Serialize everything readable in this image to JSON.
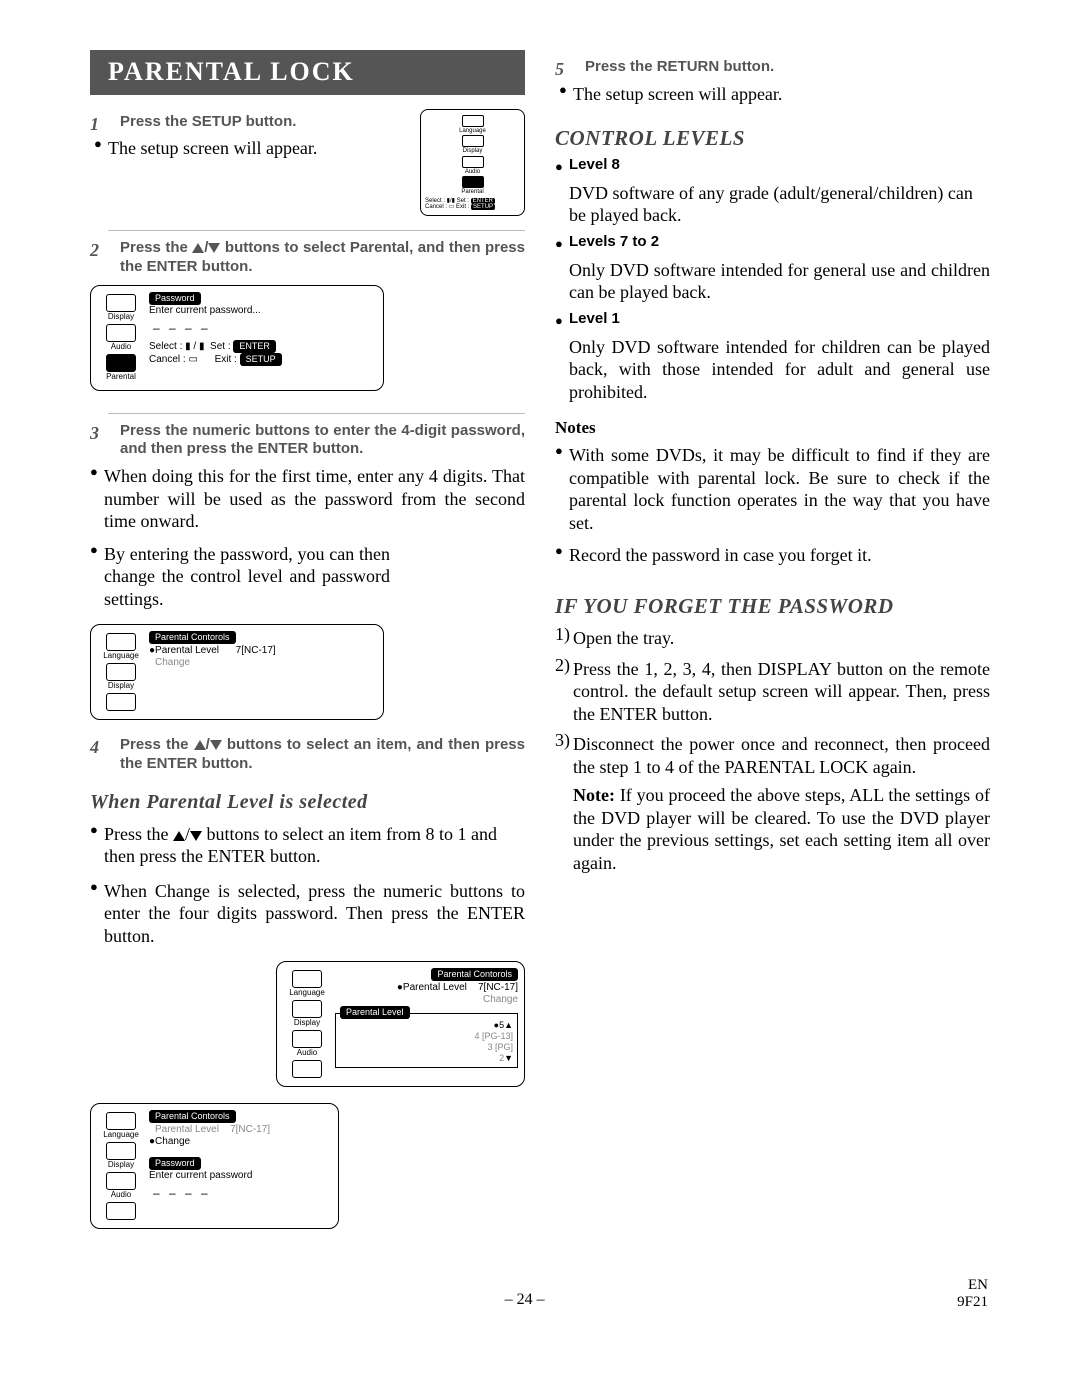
{
  "title": "PARENTAL LOCK",
  "left": {
    "step1": {
      "num": "1",
      "head": "Press the SETUP button.",
      "b1": "The setup screen will appear."
    },
    "step2": {
      "num": "2",
      "head_a": "Press the ",
      "head_b": " buttons to select Parental, and then press the ENTER button."
    },
    "step3": {
      "num": "3",
      "head": "Press the numeric buttons to enter the 4-digit password, and then press the ENTER button.",
      "b1": "When doing this for the first time, enter any 4 digits. That number will be used as the password from the second time onward.",
      "b2": "By entering the password, you can then change the control level and password settings."
    },
    "step4": {
      "num": "4",
      "head_a": "Press the ",
      "head_b": " buttons to select an item, and then press the ENTER button."
    },
    "subhead": "When Parental Level is selected",
    "sb1a": "Press the ",
    "sb1b": " buttons to select an item from  8 to 1 and then press the ENTER button.",
    "sb2": "When Change is selected, press the numeric buttons to enter the four digits password. Then press the ENTER button."
  },
  "right": {
    "step5": {
      "num": "5",
      "head": "Press the RETURN button.",
      "b1": "The setup screen will appear."
    },
    "ctrl_head": "CONTROL LEVELS",
    "l8h": "Level 8",
    "l8t": "DVD software of any grade (adult/general/children) can be played back.",
    "l72h": "Levels 7 to 2",
    "l72t": "Only DVD software intended for general use and children can be played back.",
    "l1h": "Level 1",
    "l1t": "Only DVD software intended for children can be played back, with those intended for adult and general use prohibited.",
    "notes_h": "Notes",
    "n1": "With some DVDs, it may be difficult to find if they are compatible with parental lock. Be sure to check if the parental lock function operates in the way that you have set.",
    "n2": "Record the password in case you forget it.",
    "forgot_h": "IF YOU FORGET THE PASSWORD",
    "f1": "Open the tray.",
    "f2": "Press the 1, 2, 3, 4, then DISPLAY button on the remote control. the default setup screen will appear. Then, press the ENTER button.",
    "f3": "Disconnect the power once and reconnect, then proceed the step 1 to 4 of the PARENTAL LOCK again.",
    "note_lead": "Note: ",
    "note_body": "If you proceed the above steps, ALL the settings of the DVD player will be cleared. To use the DVD player under the previous settings, set each setting item all over again."
  },
  "osd": {
    "menu_language": "Language",
    "menu_display": "Display",
    "menu_audio": "Audio",
    "menu_parental": "Parental",
    "password": "Password",
    "enter_pw": "Enter current password...",
    "enter_pw2": "Enter current password",
    "select": "Select :",
    "set": "Set :",
    "enter": "ENTER",
    "cancel": "Cancel :",
    "exit": "Exit :",
    "setup": "SETUP",
    "pc_title": "Parental Contorols",
    "p_level": "Parental Level",
    "nc17": "7[NC-17]",
    "change": "Change",
    "pl_title": "Parental Level",
    "lv5": "5",
    "lv4": "4 [PG-13]",
    "lv3": "3 [PG]",
    "lv2": "2"
  },
  "footer": {
    "page": "– 24 –",
    "lang": "EN",
    "code": "9F21"
  }
}
